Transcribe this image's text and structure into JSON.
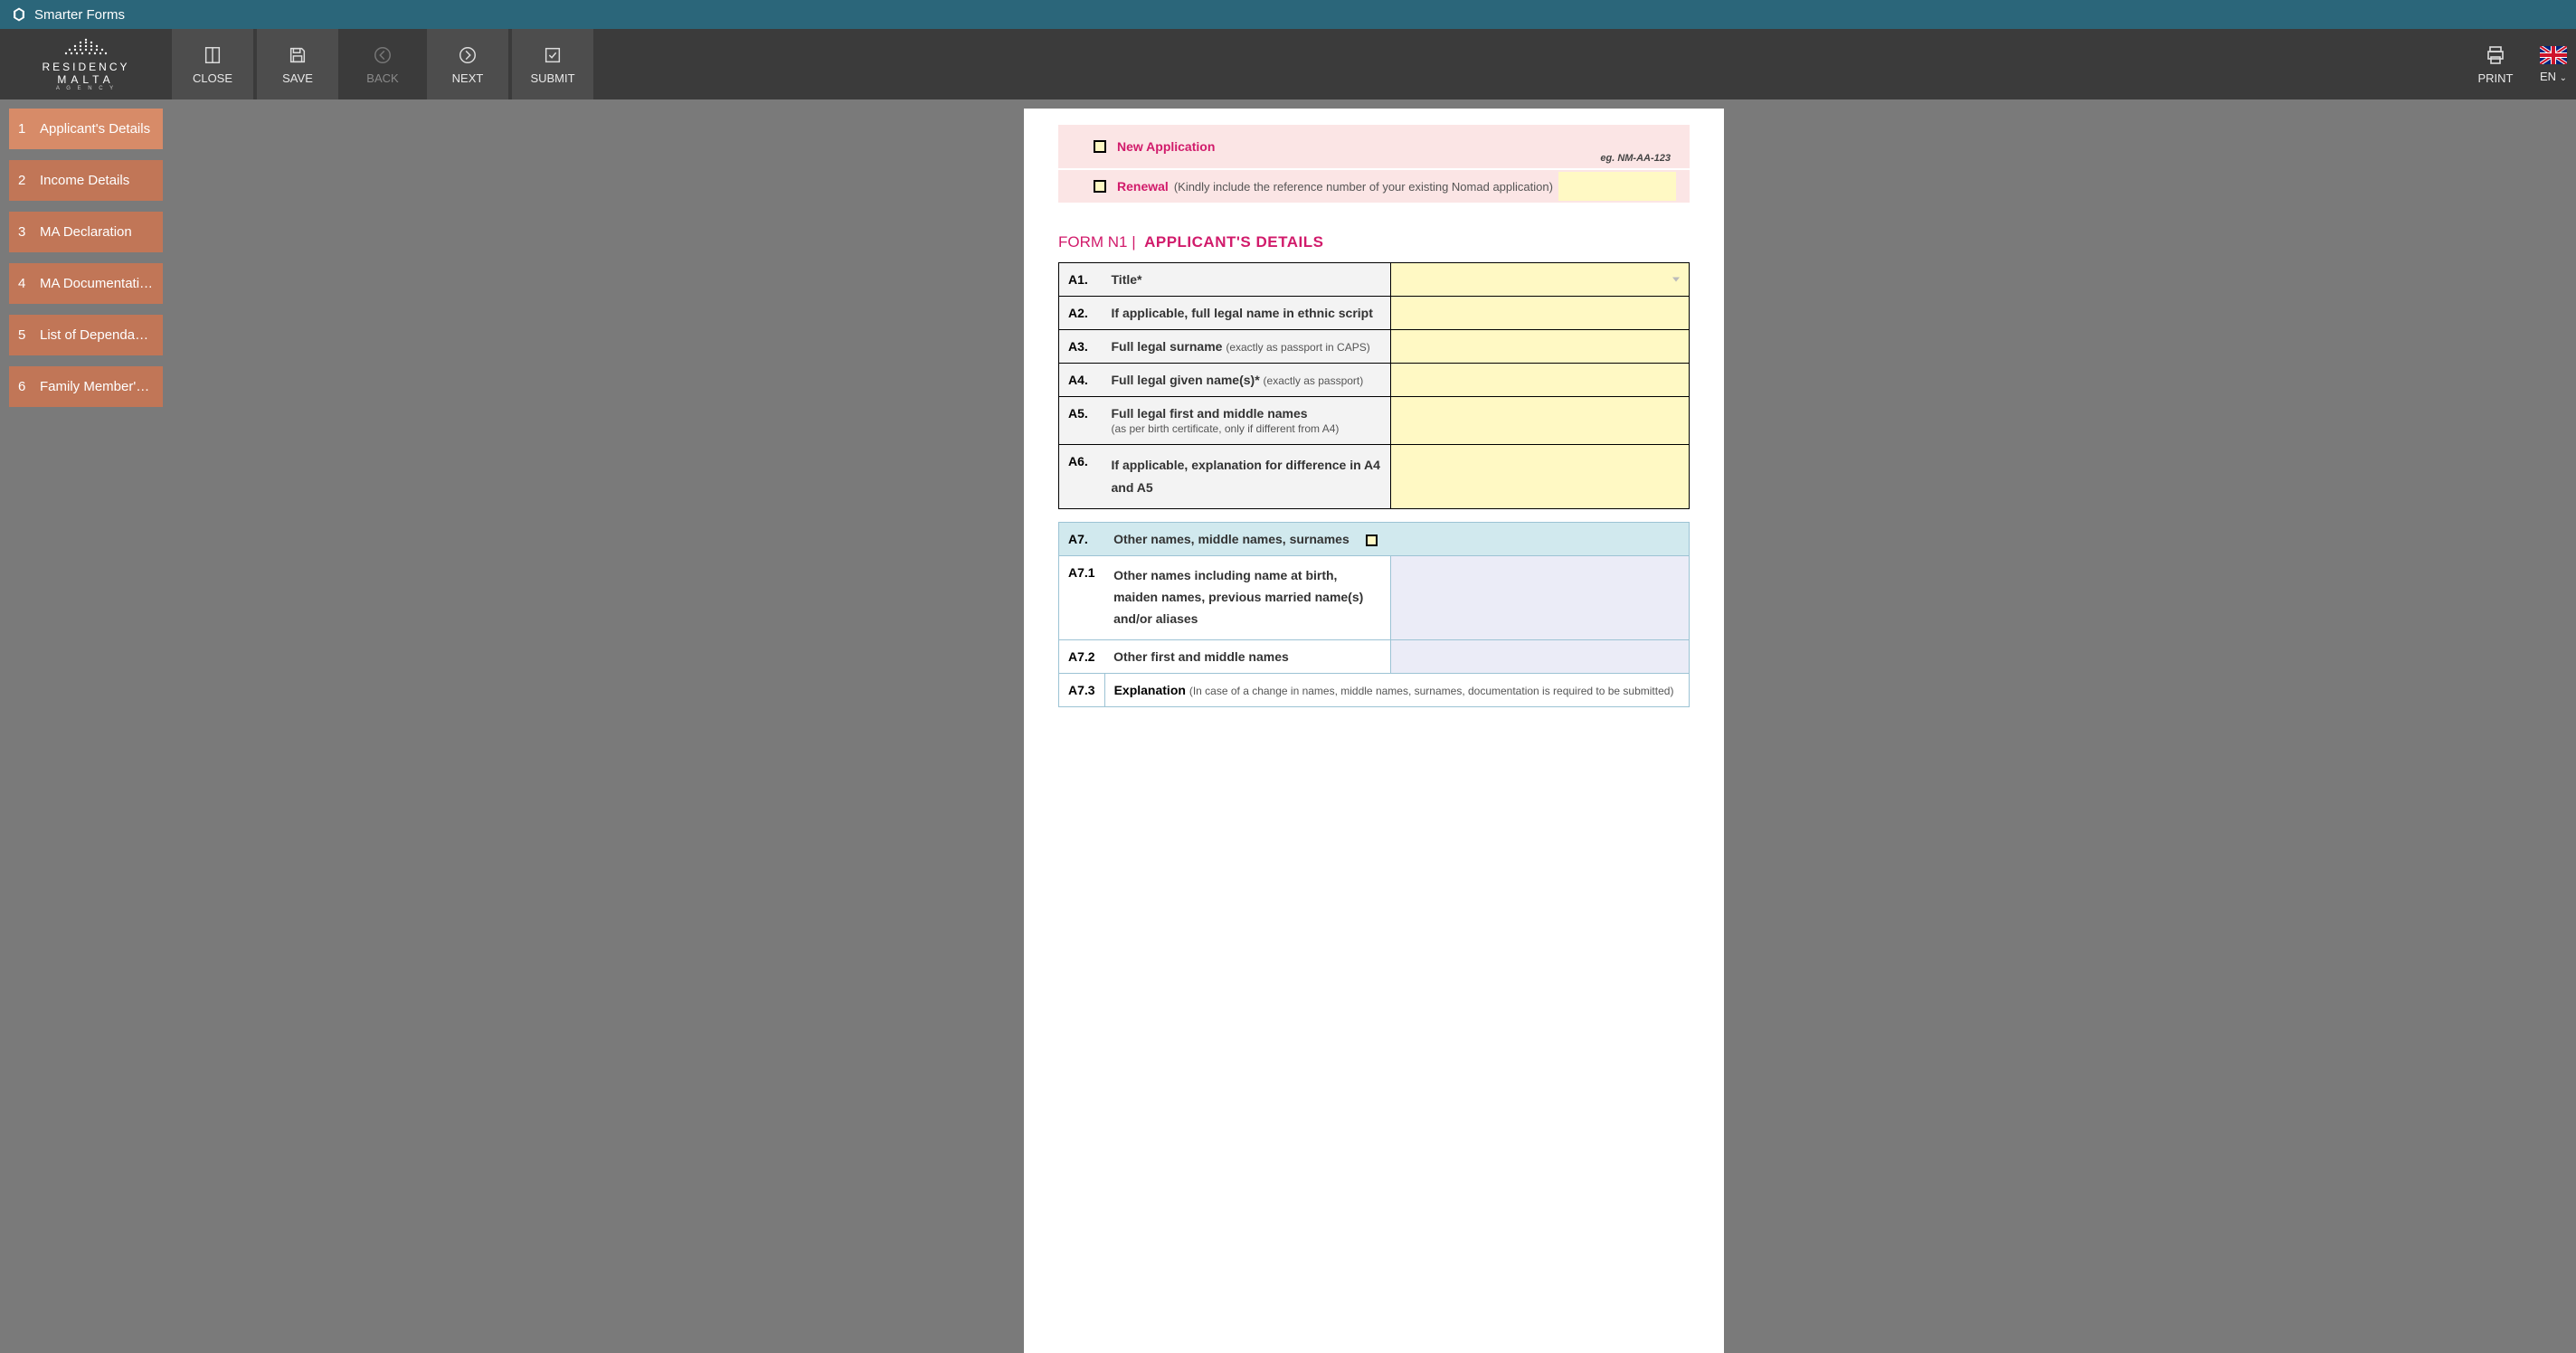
{
  "app": {
    "title": "Smarter Forms"
  },
  "brand": {
    "line1": "RESIDENCY",
    "line2": "MALTA",
    "line3": "A G E N C Y"
  },
  "toolbar": {
    "close": "CLOSE",
    "save": "SAVE",
    "back": "BACK",
    "next": "NEXT",
    "submit": "SUBMIT",
    "print": "PRINT",
    "lang": "EN"
  },
  "sidebar": {
    "items": [
      {
        "num": "1",
        "label": "Applicant's Details",
        "active": true
      },
      {
        "num": "2",
        "label": "Income Details"
      },
      {
        "num": "3",
        "label": "MA Declaration"
      },
      {
        "num": "4",
        "label": "MA Documentati…"
      },
      {
        "num": "5",
        "label": "List of Dependa…"
      },
      {
        "num": "6",
        "label": "Family Member's…"
      }
    ]
  },
  "apptype": {
    "new_label": "New Application",
    "renewal_label": "Renewal",
    "renewal_hint": "(Kindly include the reference number of your existing Nomad application)",
    "eg": "eg. NM-AA-123"
  },
  "form": {
    "title_pre": "FORM N1 |",
    "title_main": "APPLICANT'S DETAILS",
    "rows": {
      "A1": {
        "num": "A1.",
        "label": "Title*"
      },
      "A2": {
        "num": "A2.",
        "label": "If applicable, full legal name in ethnic script"
      },
      "A3": {
        "num": "A3.",
        "label": "Full legal surname",
        "sub": "(exactly as passport in CAPS)"
      },
      "A4": {
        "num": "A4.",
        "label": "Full legal given name(s)*",
        "sub": "(exactly as passport)"
      },
      "A5": {
        "num": "A5.",
        "label": "Full legal first and middle names",
        "sub": "(as per birth certificate, only if different from A4)"
      },
      "A6": {
        "num": "A6.",
        "label": "If applicable, explanation for difference in A4 and A5"
      }
    },
    "a7block": {
      "A7": {
        "num": "A7.",
        "label": "Other names, middle names, surnames"
      },
      "A71": {
        "num": "A7.1",
        "label": "Other names including name at birth, maiden names, previous married name(s) and/or aliases"
      },
      "A72": {
        "num": "A7.2",
        "label": "Other first and middle names"
      },
      "A73": {
        "num": "A7.3",
        "label": "Explanation",
        "sub": "(In case of a change in names, middle names, surnames, documentation is required to be submitted)"
      }
    }
  }
}
